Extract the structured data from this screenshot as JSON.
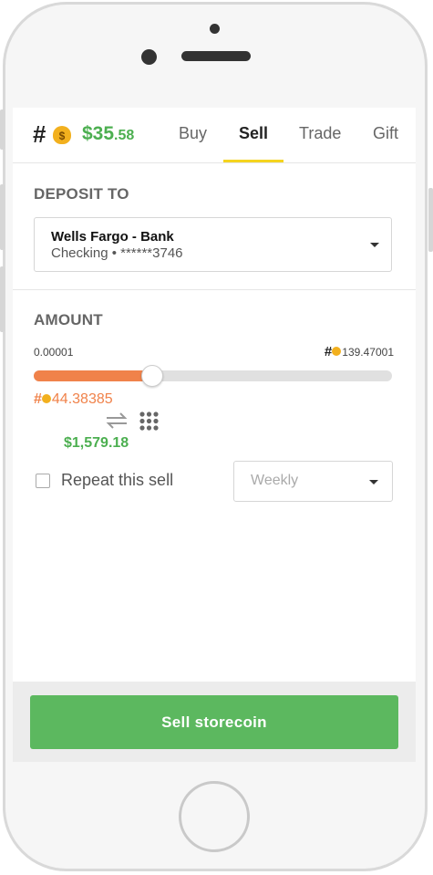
{
  "brand": {
    "symbol": "#",
    "balance_whole": "$35",
    "balance_cents": ".58"
  },
  "tabs": [
    {
      "label": "Buy",
      "active": false
    },
    {
      "label": "Sell",
      "active": true
    },
    {
      "label": "Trade",
      "active": false
    },
    {
      "label": "Gift",
      "active": false
    }
  ],
  "deposit": {
    "section_label": "DEPOSIT TO",
    "account_name": "Wells Fargo - Bank",
    "account_detail": "Checking • ******3746"
  },
  "amount": {
    "section_label": "AMOUNT",
    "min": "0.00001",
    "max_symbol": "#",
    "max": "139.47001",
    "slider_fraction": 0.33,
    "coin_symbol": "#",
    "coin_value": "44.38385",
    "usd_value": "$1,579.18"
  },
  "repeat": {
    "label": "Repeat this sell",
    "checked": false,
    "frequency": "Weekly"
  },
  "action": {
    "button_label": "Sell storecoin"
  },
  "colors": {
    "accent_green": "#5cb85f",
    "slider_orange": "#f0824a",
    "tab_underline": "#f5d41f"
  }
}
